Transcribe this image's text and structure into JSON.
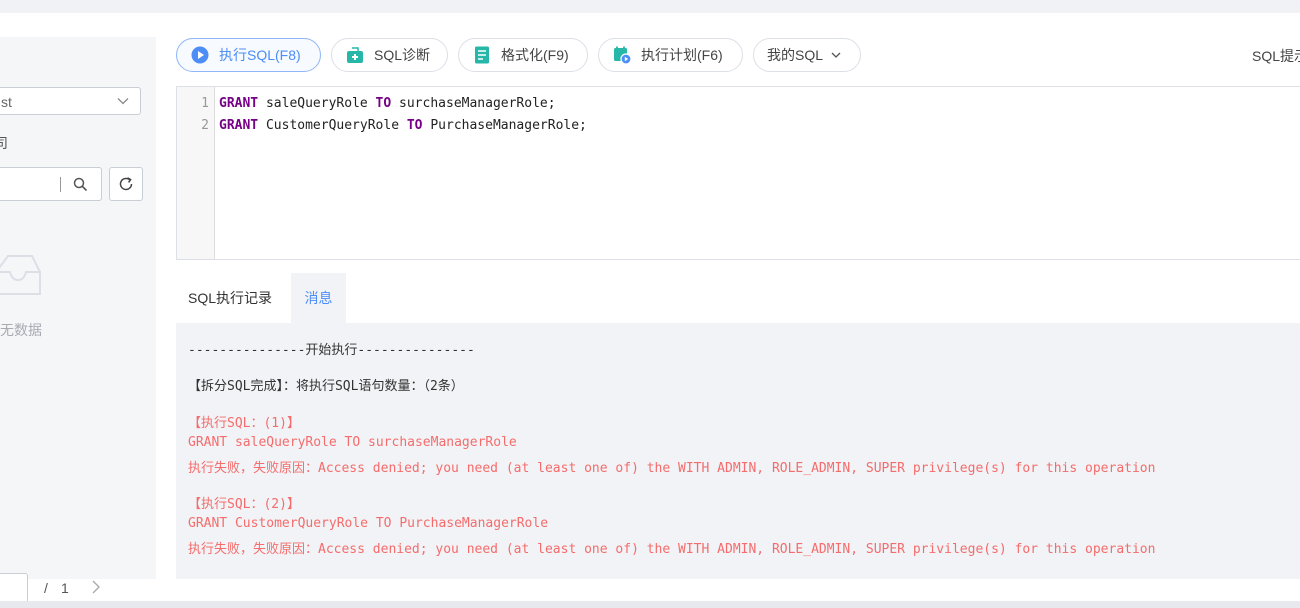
{
  "left_panel": {
    "db_select_value": "st",
    "label_fragment": "司",
    "search_placeholder": "",
    "empty_text": "无数据",
    "pagination": {
      "slash": "/",
      "total": "1"
    }
  },
  "toolbar": {
    "run_label": "执行SQL(F8)",
    "diagnose_label": "SQL诊断",
    "format_label": "格式化(F9)",
    "plan_label": "执行计划(F6)",
    "my_sql_label": "我的SQL",
    "hint_label": "SQL提示"
  },
  "editor": {
    "lines": [
      {
        "number": "1",
        "kw1": "GRANT",
        "role": " saleQueryRole ",
        "kw2": "TO",
        "target": " surchaseManagerRole;"
      },
      {
        "number": "2",
        "kw1": "GRANT",
        "role": " CustomerQueryRole ",
        "kw2": "TO",
        "target": " PurchaseManagerRole;"
      }
    ]
  },
  "tabs": {
    "history": "SQL执行记录",
    "messages": "消息"
  },
  "messages": {
    "start": "---------------开始执行---------------",
    "split": "【拆分SQL完成】：将执行SQL语句数量：（2条）",
    "block1_header": "【执行SQL：(1)】",
    "block1_sql": "GRANT saleQueryRole TO surchaseManagerRole",
    "block1_error": "执行失败，失败原因：Access denied; you need (at least one of) the WITH ADMIN, ROLE_ADMIN, SUPER privilege(s) for this operation",
    "block2_header": "【执行SQL：(2)】",
    "block2_sql": "GRANT CustomerQueryRole TO PurchaseManagerRole",
    "block2_error": "执行失败，失败原因：Access denied; you need (at least one of) the WITH ADMIN, ROLE_ADMIN, SUPER privilege(s) for this operation"
  },
  "colors": {
    "accent": "#4c8df6",
    "error": "#f56c6c",
    "teal": "#26b7a8",
    "keyword": "#770088"
  }
}
